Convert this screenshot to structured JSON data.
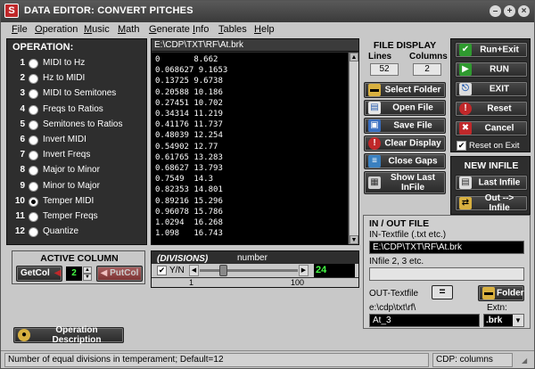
{
  "window": {
    "title": "DATA EDITOR: CONVERT PITCHES"
  },
  "menu": [
    "File",
    "Operation",
    "Music",
    "Math",
    "Generate",
    "Info",
    "Tables",
    "Help"
  ],
  "operation": {
    "title": "OPERATION:",
    "selected_index": 9,
    "items": [
      {
        "num": "1",
        "label": "MIDI to Hz"
      },
      {
        "num": "2",
        "label": "Hz to MIDI"
      },
      {
        "num": "3",
        "label": "MIDI to Semitones"
      },
      {
        "num": "4",
        "label": "Freqs to Ratios"
      },
      {
        "num": "5",
        "label": "Semitones to Ratios"
      },
      {
        "num": "6",
        "label": "Invert MIDI"
      },
      {
        "num": "7",
        "label": "Invert Freqs"
      },
      {
        "num": "8",
        "label": "Major to Minor"
      },
      {
        "num": "9",
        "label": "Minor to Major"
      },
      {
        "num": "10",
        "label": "Temper MIDI"
      },
      {
        "num": "11",
        "label": "Temper Freqs"
      },
      {
        "num": "12",
        "label": "Quantize"
      }
    ]
  },
  "file_view": {
    "path": "E:\\CDP\\TXT\\RF\\At.brk",
    "lines": [
      "0       8.662",
      "0.068627 9.1653",
      "0.13725 9.6738",
      "0.20588 10.186",
      "0.27451 10.702",
      "0.34314 11.219",
      "0.41176 11.737",
      "0.48039 12.254",
      "0.54902 12.77",
      "0.61765 13.283",
      "0.68627 13.793",
      "0.7549  14.3",
      "0.82353 14.801",
      "0.89216 15.296",
      "0.96078 15.786",
      "1.0294  16.268",
      "1.098   16.743"
    ]
  },
  "file_display": {
    "title": "FILE DISPLAY",
    "lines_label": "Lines",
    "columns_label": "Columns",
    "lines": "52",
    "columns": "2"
  },
  "mid_buttons": {
    "select_folder": "Select Folder",
    "open_file": "Open File",
    "save_file": "Save File",
    "clear_display": "Clear Display",
    "close_gaps": "Close Gaps",
    "show_last_infile": "Show Last InFile"
  },
  "controls": {
    "run_exit": "Run+Exit",
    "run": "RUN",
    "exit": "EXIT",
    "reset": "Reset",
    "cancel": "Cancel",
    "reset_on_exit": "Reset on Exit"
  },
  "new_infile": {
    "title": "NEW INFILE",
    "last_infile": "Last Infile",
    "out_infile": "Out --> Infile"
  },
  "inout": {
    "title": "IN / OUT FILE",
    "in_label": "IN-Textfile (.txt etc.)",
    "in_value": "E:\\CDP\\TXT\\RF\\At.brk",
    "infile23_label": "INfile 2, 3 etc.",
    "infile23_value": "",
    "out_label": "OUT-Textfile",
    "equals": "=",
    "folder": "Folder",
    "out_dir": "e:\\cdp\\txt\\rf\\",
    "extn_label": "Extn:",
    "out_name": "At_3",
    "extn": ".brk"
  },
  "active_column": {
    "title": "ACTIVE COLUMN",
    "getcol": "GetCol",
    "putcol": "PutCol",
    "value": "2"
  },
  "divisions": {
    "title": "(DIVISIONS)",
    "yn_label": "Y/N",
    "number_label": "number",
    "min": "1",
    "max": "100",
    "value": "24",
    "level": 0.24
  },
  "op_description": "Operation Description",
  "status": {
    "message": "Number of equal divisions in temperament; Default=12",
    "right": "CDP:  columns"
  },
  "colors": {
    "title_bg": "#3a3a3a",
    "panel_dark": "#2e2e2e",
    "accent_red": "#c0282a",
    "accent_green": "#2f9a2f",
    "field_black": "#000000",
    "value_green": "#44ff44"
  }
}
